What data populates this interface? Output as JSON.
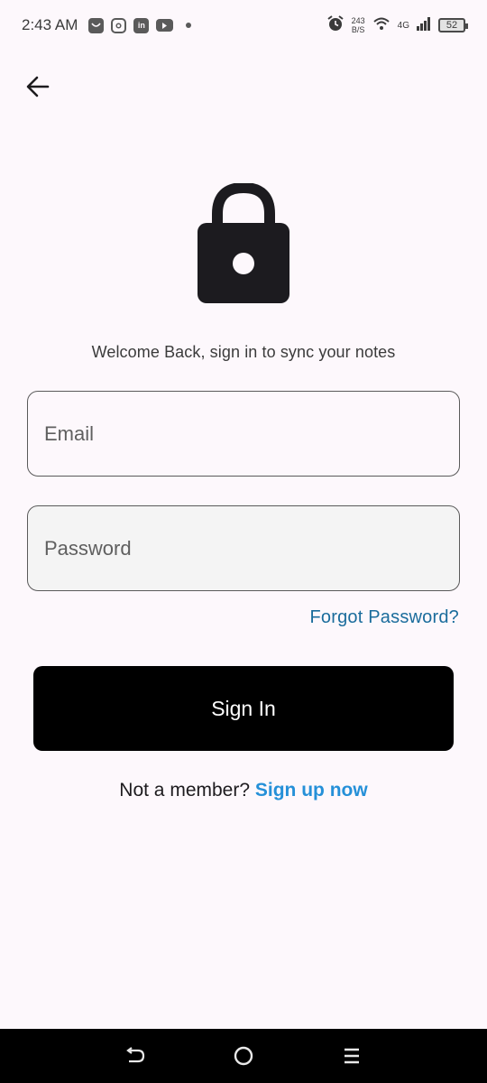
{
  "status_bar": {
    "time": "2:43 AM",
    "notification_icons": [
      "shopping-bag-icon",
      "instagram-icon",
      "linkedin-icon",
      "youtube-icon"
    ],
    "net_speed_value": "243",
    "net_speed_unit": "B/S",
    "network_type": "4G",
    "battery": "52"
  },
  "header": {
    "back_icon": "arrow-left-icon"
  },
  "hero": {
    "icon": "lock-icon",
    "welcome_text": "Welcome Back, sign in to sync your notes"
  },
  "form": {
    "email_placeholder": "Email",
    "password_placeholder": "Password",
    "forgot_password": "Forgot Password?",
    "sign_in": "Sign In"
  },
  "signup": {
    "prompt": "Not a member?",
    "link": "Sign up now"
  },
  "colors": {
    "background": "#fdf8fc",
    "link_primary": "#2590d8",
    "link_secondary": "#1a6c9c",
    "button": "#000000"
  },
  "nav_bar": {
    "icons": [
      "back-nav-icon",
      "home-nav-icon",
      "recents-nav-icon"
    ]
  }
}
